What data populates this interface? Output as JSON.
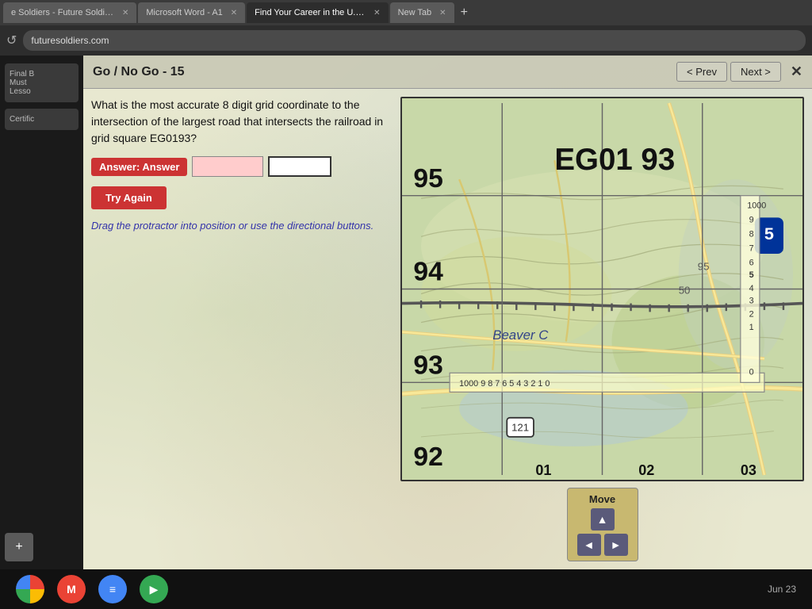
{
  "browser": {
    "tabs": [
      {
        "label": "e Soldiers - Future Soldiers",
        "active": false,
        "id": "tab1"
      },
      {
        "label": "Microsoft Word - A1",
        "active": false,
        "id": "tab2"
      },
      {
        "label": "Find Your Career in the U.S. A...",
        "active": true,
        "id": "tab3"
      },
      {
        "label": "New Tab",
        "active": false,
        "id": "tab4"
      }
    ],
    "address": "futuresoldiers.com"
  },
  "quiz": {
    "title": "Go / No Go - 15",
    "prev_label": "< Prev",
    "next_label": "Next >",
    "question": "What is the most accurate 8 digit grid coordinate to the intersection of the largest road that intersects the railroad in grid square EG0193?",
    "answer_label": "Answer: Answer",
    "input1_value": "",
    "input2_value": "",
    "try_again_label": "Try Again",
    "drag_hint": "Drag the protractor into position or use the directional buttons.",
    "move_label": "Move"
  },
  "map": {
    "grid_ref": "EG01    93",
    "coord_95": "95",
    "coord_94": "94",
    "coord_93": "93",
    "coord_92": "92",
    "coord_1000": "1000",
    "coord_01": "01",
    "coord_02": "02",
    "coord_03": "03",
    "place_name": "Beaver C"
  },
  "taskbar": {
    "date": "Jun 23",
    "icons": [
      "chrome",
      "gmail",
      "docs",
      "media"
    ]
  },
  "sidebar": {
    "items": [
      {
        "label": "Final B\nMust\nLesso"
      },
      {
        "label": "Certific"
      }
    ],
    "add_label": "+"
  },
  "move_buttons": {
    "up": "▲",
    "left": "◄",
    "right": "►",
    "down": "▼"
  }
}
